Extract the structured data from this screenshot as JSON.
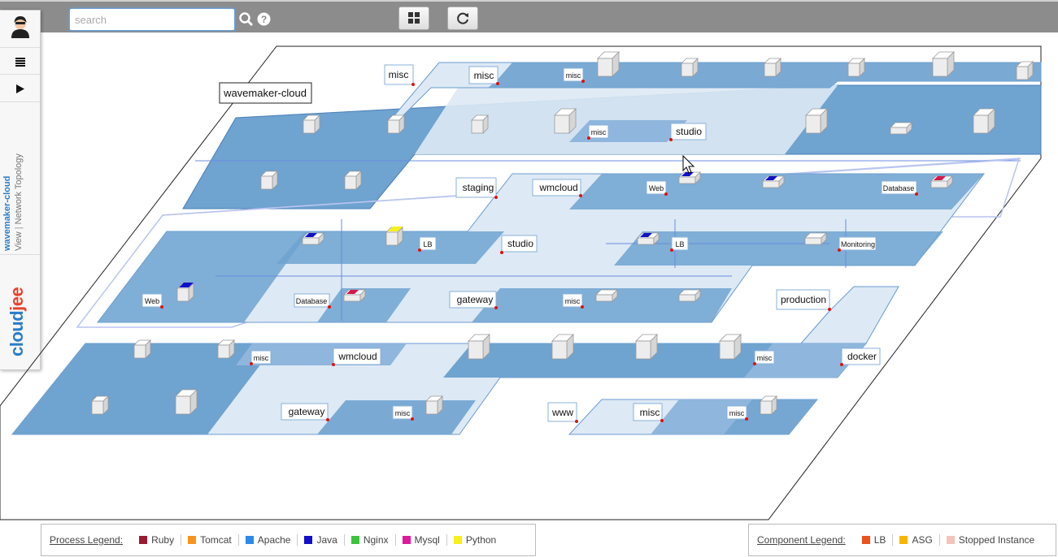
{
  "search": {
    "placeholder": "search"
  },
  "sidebar": {
    "app_name": "wavemaker-cloud",
    "view_label": "View",
    "separator": "|",
    "page_label": "Network Topology",
    "logo_cloud": "cloud",
    "logo_jee": "jee"
  },
  "topology": {
    "root_label": "wavemaker-cloud",
    "nodes": [
      "misc",
      "misc",
      "misc",
      "studio",
      "misc",
      "staging",
      "wmcloud",
      "Web",
      "Database",
      "LB",
      "studio",
      "LB",
      "Monitoring",
      "Web",
      "Database",
      "gateway",
      "misc",
      "production",
      "misc",
      "wmcloud",
      "misc",
      "docker",
      "gateway",
      "misc",
      "www",
      "misc",
      "misc"
    ]
  },
  "process_legend": {
    "title": "Process Legend:",
    "items": [
      {
        "label": "Ruby",
        "color": "#9b1b30"
      },
      {
        "label": "Tomcat",
        "color": "#f7941d"
      },
      {
        "label": "Apache",
        "color": "#2b8ae8"
      },
      {
        "label": "Java",
        "color": "#1010c8"
      },
      {
        "label": "Nginx",
        "color": "#3cc43c"
      },
      {
        "label": "Mysql",
        "color": "#e0189e"
      },
      {
        "label": "Python",
        "color": "#f7f01a"
      }
    ]
  },
  "component_legend": {
    "title": "Component Legend:",
    "items": [
      {
        "label": "LB",
        "color": "#e8531e"
      },
      {
        "label": "ASG",
        "color": "#f7b500"
      },
      {
        "label": "Stopped Instance",
        "color": "#f2c4bc"
      }
    ]
  }
}
